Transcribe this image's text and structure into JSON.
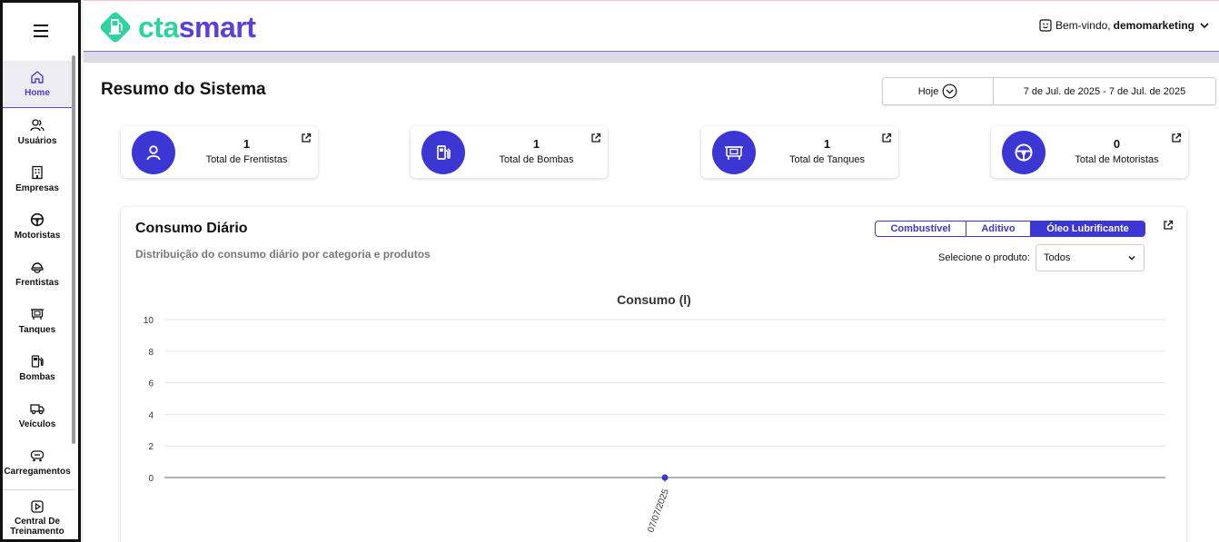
{
  "sidebar": {
    "items": [
      {
        "label": "Home",
        "icon": "home-icon",
        "active": true
      },
      {
        "label": "Usuários",
        "icon": "users-icon"
      },
      {
        "label": "Empresas",
        "icon": "building-icon"
      },
      {
        "label": "Motoristas",
        "icon": "steering-wheel-icon"
      },
      {
        "label": "Frentistas",
        "icon": "helmet-icon"
      },
      {
        "label": "Tanques",
        "icon": "tank-icon"
      },
      {
        "label": "Bombas",
        "icon": "fuel-pump-icon"
      },
      {
        "label": "Veículos",
        "icon": "truck-icon"
      },
      {
        "label": "Carregamentos",
        "icon": "tanker-icon"
      }
    ],
    "training": {
      "line1": "Central De",
      "line2": "Treinamento",
      "icon": "play-icon"
    }
  },
  "header": {
    "logo_prefix": "cta",
    "logo_suffix": "smart",
    "welcome": "Bem-vindo,",
    "username": "demomarketing"
  },
  "page": {
    "title": "Resumo do Sistema",
    "date_range": {
      "selected": "Hoje",
      "value": "7 de Jul. de 2025 - 7 de Jul. de 2025"
    }
  },
  "stats": [
    {
      "value": "1",
      "caption": "Total de Frentistas",
      "icon": "person-icon"
    },
    {
      "value": "1",
      "caption": "Total de Bombas",
      "icon": "fuel-pump-icon"
    },
    {
      "value": "1",
      "caption": "Total de Tanques",
      "icon": "tank-icon"
    },
    {
      "value": "0",
      "caption": "Total de Motoristas",
      "icon": "steering-wheel-icon"
    }
  ],
  "panel": {
    "title": "Consumo Diário",
    "subtitle": "Distribuição do consumo diário por categoria e produtos",
    "tabs": [
      "Combustível",
      "Aditivo",
      "Óleo Lubrificante"
    ],
    "active_tab": 2,
    "product_label": "Selecione o produto:",
    "product_value": "Todos"
  },
  "colors": {
    "accent": "#3b36d4",
    "logo_green": "#2dd4a0",
    "logo_purple": "#5b3fd6"
  },
  "chart_data": {
    "type": "line",
    "title": "Consumo (l)",
    "x": [
      "07/07/2025"
    ],
    "series": [
      {
        "values": [
          0
        ]
      }
    ],
    "yticks": [
      10,
      8,
      6,
      4,
      2,
      0
    ],
    "ylim": [
      0,
      10
    ],
    "grid": true
  }
}
